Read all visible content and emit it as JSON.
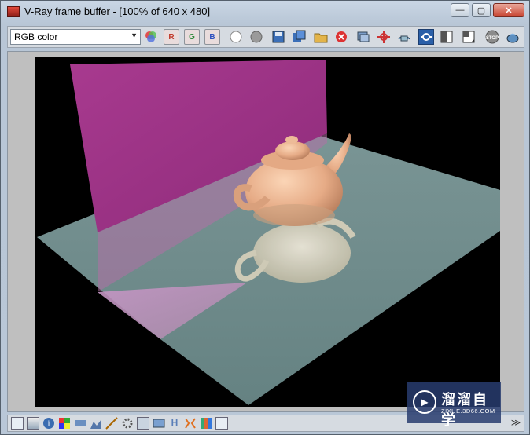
{
  "window": {
    "title": "V-Ray frame buffer - [100% of 640 x 480]"
  },
  "window_controls": {
    "minimize": "—",
    "restore": "▢",
    "close": "✕"
  },
  "toolbar": {
    "channel_select": "RGB color",
    "red_channel": "R",
    "green_channel": "G",
    "blue_channel": "B"
  },
  "statusbar": {
    "h_label": "H"
  },
  "watermark": {
    "text": "溜溜自学",
    "subtext": "ZIXUE.3D66.COM"
  },
  "colors": {
    "wall": "#a0388b",
    "floor": "#6f8b8c",
    "teapot": "#e7b08d",
    "background": "#000000"
  }
}
